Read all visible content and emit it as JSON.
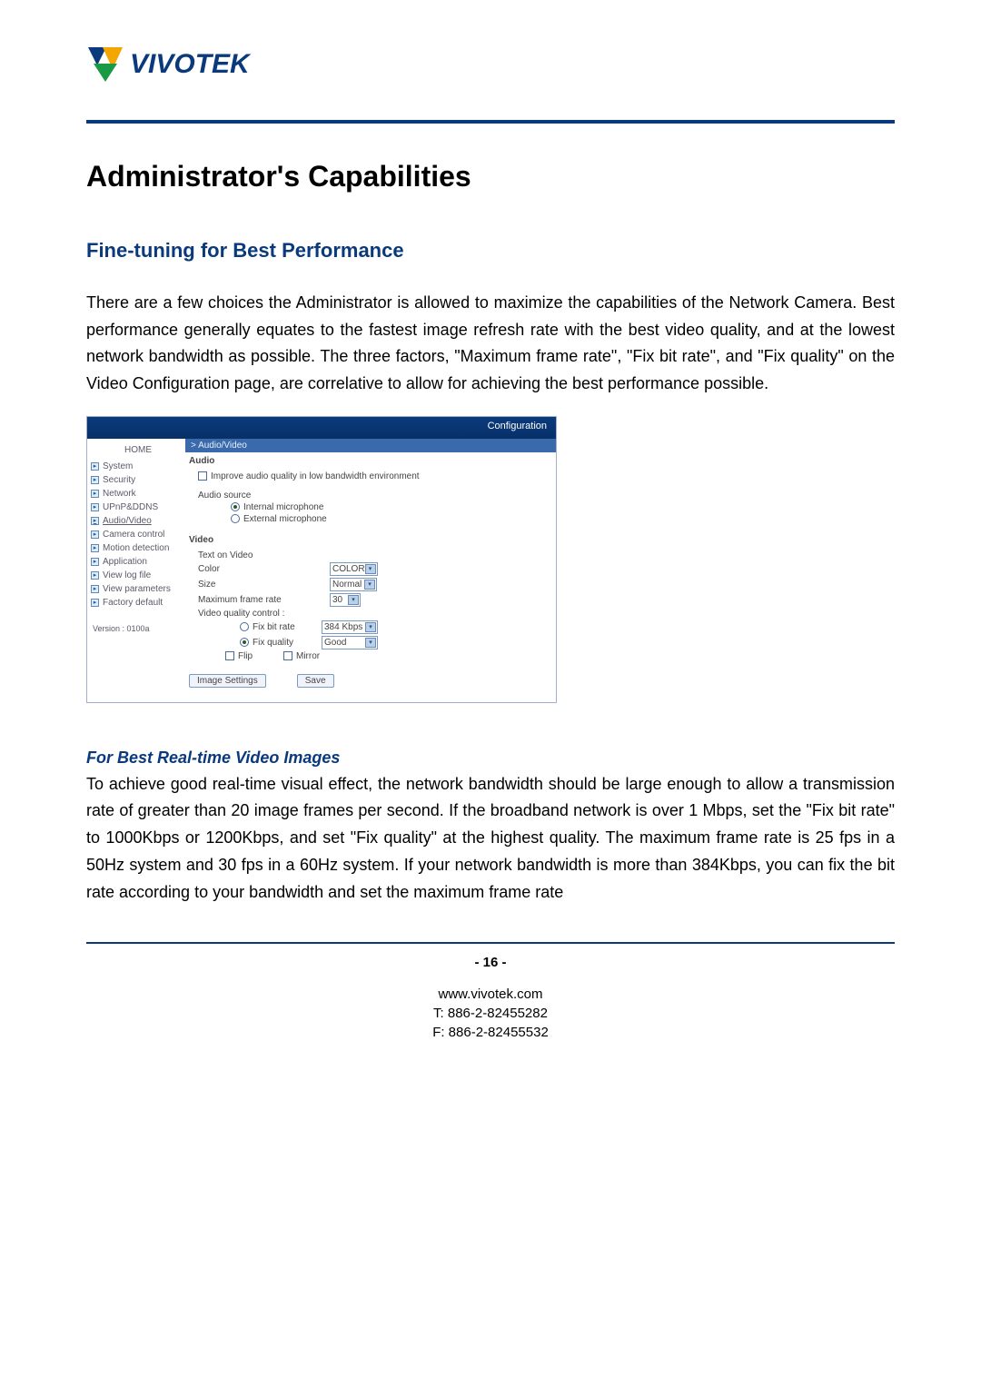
{
  "logo": {
    "brand": "VIVOTEK"
  },
  "h1": "Administrator's Capabilities",
  "h2": "Fine-tuning for Best Performance",
  "para1": "There are a few choices the Administrator is allowed to maximize the capabilities of the Network Camera.  Best performance generally equates to the fastest image refresh rate with the best video quality, and at the lowest network bandwidth as possible. The three factors, \"Maximum frame rate\", \"Fix bit rate\", and \"Fix quality\" on the Video Configuration page, are correlative to allow for achieving the best performance possible.",
  "h3": "For Best Real-time Video Images",
  "para2": "To achieve good real-time visual effect, the network bandwidth should be large enough to allow a transmission rate of greater than 20 image frames per second.  If the broadband network is over 1 Mbps, set the \"Fix bit rate\" to 1000Kbps or 1200Kbps, and set \"Fix quality\" at the highest quality. The maximum frame rate is 25 fps in a 50Hz system and 30 fps in a 60Hz system. If your network bandwidth is more than 384Kbps, you can fix the bit rate according to your bandwidth and set the maximum frame rate",
  "config": {
    "title": "Configuration",
    "home": "HOME",
    "nav": [
      "System",
      "Security",
      "Network",
      "UPnP&DDNS",
      "Audio/Video",
      "Camera control",
      "Motion detection",
      "Application",
      "View log file",
      "View parameters",
      "Factory default"
    ],
    "active_index": 4,
    "version": "Version : 0100a",
    "breadcrumb": ">  Audio/Video",
    "audio": {
      "heading": "Audio",
      "improve": "Improve audio quality in low bandwidth environment",
      "source_label": "Audio source",
      "internal": "Internal microphone",
      "external": "External microphone"
    },
    "video": {
      "heading": "Video",
      "text_on_video": "Text on Video",
      "color_label": "Color",
      "color_value": "COLOR",
      "size_label": "Size",
      "size_value": "Normal",
      "maxfr_label": "Maximum frame rate",
      "maxfr_value": "30",
      "vqc": "Video quality control :",
      "fixbit_label": "Fix bit rate",
      "fixbit_value": "384 Kbps",
      "fixqual_label": "Fix quality",
      "fixqual_value": "Good",
      "flip": "Flip",
      "mirror": "Mirror"
    },
    "buttons": {
      "image_settings": "Image Settings",
      "save": "Save"
    }
  },
  "footer": {
    "page": "- 16 -",
    "url": "www.vivotek.com",
    "tel": "T: 886-2-82455282",
    "fax": "F: 886-2-82455532"
  }
}
